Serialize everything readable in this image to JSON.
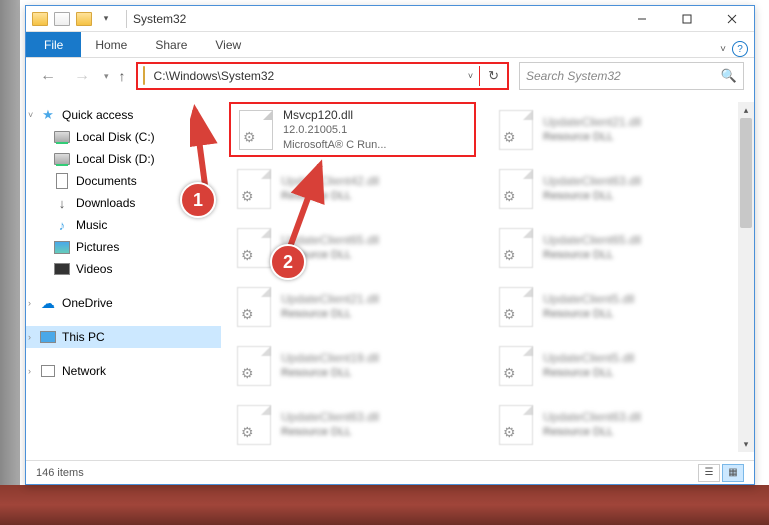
{
  "window": {
    "title": "System32"
  },
  "ribbon": {
    "file": "File",
    "tabs": [
      "Home",
      "Share",
      "View"
    ]
  },
  "addressbar": {
    "path": "C:\\Windows\\System32"
  },
  "search": {
    "placeholder": "Search System32"
  },
  "sidebar": {
    "quick_access": "Quick access",
    "items": [
      {
        "label": "Local Disk (C:)"
      },
      {
        "label": "Local Disk (D:)"
      },
      {
        "label": "Documents"
      },
      {
        "label": "Downloads"
      },
      {
        "label": "Music"
      },
      {
        "label": "Pictures"
      },
      {
        "label": "Videos"
      }
    ],
    "onedrive": "OneDrive",
    "thispc": "This PC",
    "network": "Network"
  },
  "files": [
    {
      "name": "Msvcp120.dll",
      "line2": "12.0.21005.1",
      "line3": "MicrosoftA® C Run..."
    },
    {
      "name": "UpdateClient21.dll",
      "line2": "Resource DLL"
    },
    {
      "name": "UpdateClient42.dll",
      "line2": "Resource DLL"
    },
    {
      "name": "UpdateClient63.dll",
      "line2": "Resource DLL"
    },
    {
      "name": "UpdateClient65.dll",
      "line2": "Resource DLL"
    },
    {
      "name": "UpdateClient65.dll",
      "line2": "Resource DLL"
    },
    {
      "name": "UpdateClient21.dll",
      "line2": "Resource DLL"
    },
    {
      "name": "UpdateClient5.dll",
      "line2": "Resource DLL"
    },
    {
      "name": "UpdateClient19.dll",
      "line2": "Resource DLL"
    },
    {
      "name": "UpdateClient5.dll",
      "line2": "Resource DLL"
    },
    {
      "name": "UpdateClient63.dll",
      "line2": "Resource DLL"
    },
    {
      "name": "UpdateClient63.dll",
      "line2": "Resource DLL"
    }
  ],
  "statusbar": {
    "count": "146 items"
  },
  "callouts": {
    "c1": "1",
    "c2": "2"
  }
}
